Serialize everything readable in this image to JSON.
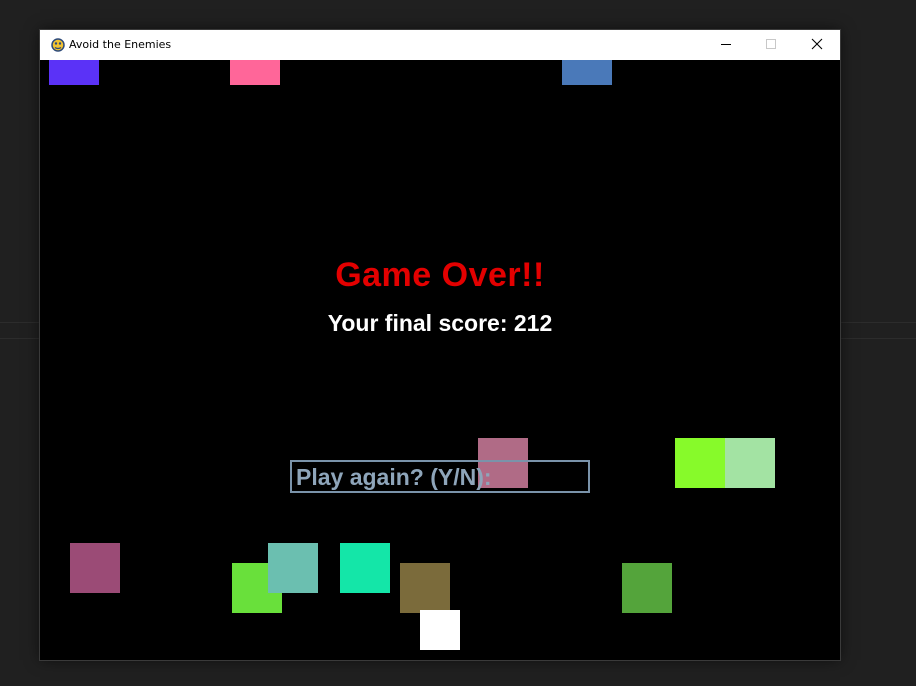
{
  "window": {
    "title": "Avoid the Enemies",
    "icon": "pygame-snake-icon",
    "controls": [
      "minimize-icon",
      "maximize-icon",
      "close-icon"
    ]
  },
  "game": {
    "game_over_text": "Game Over!!",
    "score_text": "Your final score: 212",
    "final_score": 212,
    "prompt_text": "Play again? (Y/N):",
    "input_value": "",
    "colors": {
      "game_over": "#e30000",
      "score": "#ffffff",
      "prompt": "#8ea5ba",
      "prompt_border": "#7a93aa",
      "background": "#000000",
      "player": "#ffffff"
    },
    "enemy_colors": [
      "#5b32f7",
      "#ff6699",
      "#4a79b9",
      "#b06b86",
      "#87fa2a",
      "#a3e3a3",
      "#9b4b76",
      "#69e03b",
      "#6bbfb0",
      "#14e6a8",
      "#7b6b3b",
      "#54a43b"
    ]
  }
}
